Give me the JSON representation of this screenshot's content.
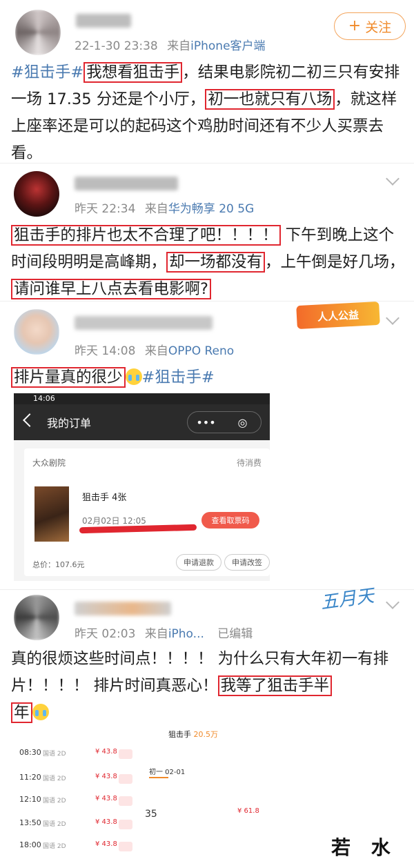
{
  "post_main": {
    "username": "",
    "timestamp": "22-1-30 23:38",
    "source_prefix": "来自",
    "source": "iPhone客户端",
    "follow_label": "关注",
    "text": {
      "hashtag": "#狙击手#",
      "hl1": "我想看狙击手",
      "seg1": "，结果电影院初二初三只有安排一场 17.35 分还是个小厅，",
      "hl2": "初一也就只有八场",
      "seg2": "，就这样上座率还是可以的起码这个鸡肋时间还有不少人买票去看。"
    }
  },
  "comment1": {
    "username": "",
    "time": "昨天 22:34",
    "source_prefix": "来自",
    "source": "华为畅享 20 5G",
    "text": {
      "hl1": "狙击手的排片也太不合理了吧！！！！",
      "seg1": " 下午到晚上这个时间段明明是高峰期，",
      "hl2": "却一场都没有",
      "seg2": "，上午倒是好几场，",
      "hl3": "请问谁早上八点去看电影啊?"
    }
  },
  "comment2": {
    "username": "",
    "time": "昨天 14:08",
    "source_prefix": "来自",
    "source": "OPPO Reno",
    "badge": "人人公益",
    "text": {
      "hl1": "排片量真的很少",
      "hashtag": "#狙击手#"
    },
    "screenshot": {
      "status_time": "14:06",
      "nav_title": "我的订单",
      "capsule_more": "•••",
      "capsule_close": "◎",
      "cinema": "大众剧院",
      "status": "待消费",
      "movie": "狙击手  4张",
      "showtime": "02月02日 12:05",
      "ticket_button": "查看取票码",
      "total": "总价：107.6元",
      "refund_button": "申请退款",
      "change_button": "申请改签"
    }
  },
  "comment3": {
    "username": "",
    "time": "昨天 02:03",
    "source_prefix": "来自",
    "source": "iPho...",
    "edited": "已编辑",
    "signature": "五月天",
    "text": {
      "seg1": "真的很烦这些时间点！！！！ 为什么只有大年初一有排片！！！！ 排片时间真恶心！",
      "hl1": "我等了狙击手半",
      "hl2": "年"
    },
    "screenshot_left": {
      "rows": [
        {
          "time": "08:30",
          "hall": "国语 2D",
          "price": "¥ 43.8"
        },
        {
          "time": "11:20",
          "hall": "国语 2D",
          "price": "¥ 43.8"
        },
        {
          "time": "12:10",
          "hall": "国语 2D",
          "price": "¥ 43.8"
        },
        {
          "time": "13:50",
          "hall": "国语 2D",
          "price": "¥ 43.8"
        },
        {
          "time": "18:00",
          "hall": "国语 2D",
          "price": "¥ 43.8"
        }
      ]
    },
    "screenshot_right": {
      "movie": "狙击手",
      "score": "20.5万",
      "date": "初一 02-01",
      "row_time": "35",
      "row_price": "¥ 61.8"
    }
  },
  "watermark": "若 水 网"
}
